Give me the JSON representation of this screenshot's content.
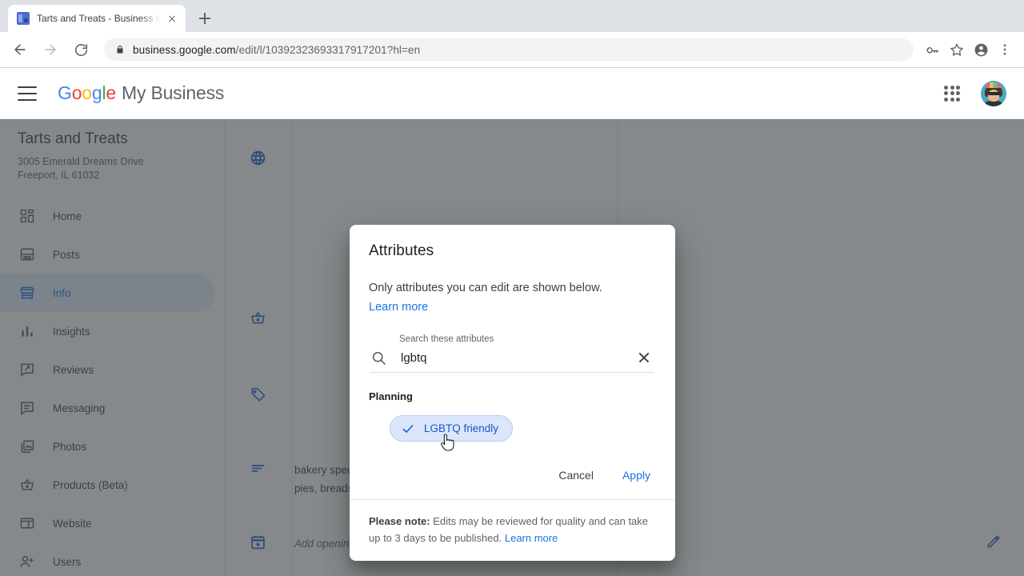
{
  "browser": {
    "tab": {
      "title": "Tarts and Treats - Business Inf",
      "favicon": "business-profile-favicon",
      "close_icon": "close-icon"
    },
    "new_tab_icon": "plus-icon",
    "nav": {
      "back_icon": "arrow-left-icon",
      "forward_icon": "arrow-right-icon",
      "reload_icon": "reload-icon"
    },
    "omnibox": {
      "lock_icon": "lock-icon",
      "url_domain": "business.google.com",
      "url_path": "/edit/l/10392323693317917201?hl=en"
    },
    "toolbar_icons": [
      "key-icon",
      "star-icon",
      "profile-icon",
      "kebab-menu-icon"
    ]
  },
  "appbar": {
    "menu_icon": "hamburger-menu-icon",
    "brand_google": "Google",
    "brand_suffix": "My Business",
    "apps_icon": "apps-grid-icon",
    "avatar": "user-avatar"
  },
  "sidebar": {
    "business_name": "Tarts and Treats",
    "address_line1": "3005 Emerald Dreams Drive",
    "address_line2": "Freeport, IL 61032",
    "items": [
      {
        "label": "Home",
        "icon": "dashboard-icon",
        "active": false
      },
      {
        "label": "Posts",
        "icon": "posts-icon",
        "active": false
      },
      {
        "label": "Info",
        "icon": "storefront-icon",
        "active": true
      },
      {
        "label": "Insights",
        "icon": "bar-chart-icon",
        "active": false
      },
      {
        "label": "Reviews",
        "icon": "review-icon",
        "active": false
      },
      {
        "label": "Messaging",
        "icon": "message-icon",
        "active": false
      },
      {
        "label": "Photos",
        "icon": "photo-library-icon",
        "active": false
      },
      {
        "label": "Products (Beta)",
        "icon": "basket-icon",
        "active": false
      },
      {
        "label": "Website",
        "icon": "website-icon",
        "active": false
      },
      {
        "label": "Users",
        "icon": "add-user-icon",
        "active": false
      }
    ]
  },
  "content": {
    "rows": [
      {
        "icon": "globe-icon",
        "text": ""
      },
      {
        "icon": "basket-icon",
        "text": ""
      },
      {
        "icon": "tag-icon",
        "text": ""
      },
      {
        "icon": "description-icon",
        "text": "bakery specializing in homemade cakes, pies, breads and tarts."
      },
      {
        "icon": "calendar-icon",
        "text": "Add opening date",
        "placeholder": true,
        "edit_icon": "pencil-icon"
      }
    ]
  },
  "dialog": {
    "title": "Attributes",
    "subtitle": "Only attributes you can edit are shown below.",
    "learn_more": "Learn more",
    "search": {
      "label": "Search these attributes",
      "value": "lgbtq",
      "placeholder": "Search these attributes",
      "search_icon": "search-icon",
      "clear_icon": "clear-icon"
    },
    "group_title": "Planning",
    "chips": [
      {
        "label": "LGBTQ friendly",
        "selected": true,
        "check_icon": "check-icon"
      }
    ],
    "cancel_label": "Cancel",
    "apply_label": "Apply",
    "note_bold": "Please note:",
    "note_text": " Edits may be reviewed for quality and can take up to 3 days to be published. ",
    "note_link": "Learn more"
  },
  "colors": {
    "accent_blue": "#1a73e8",
    "chip_fill": "#dbe6fb",
    "chip_border": "#b8cdf2",
    "active_nav_bg": "#e8f0fe",
    "scrim": "rgba(60,64,67,0.62)"
  }
}
